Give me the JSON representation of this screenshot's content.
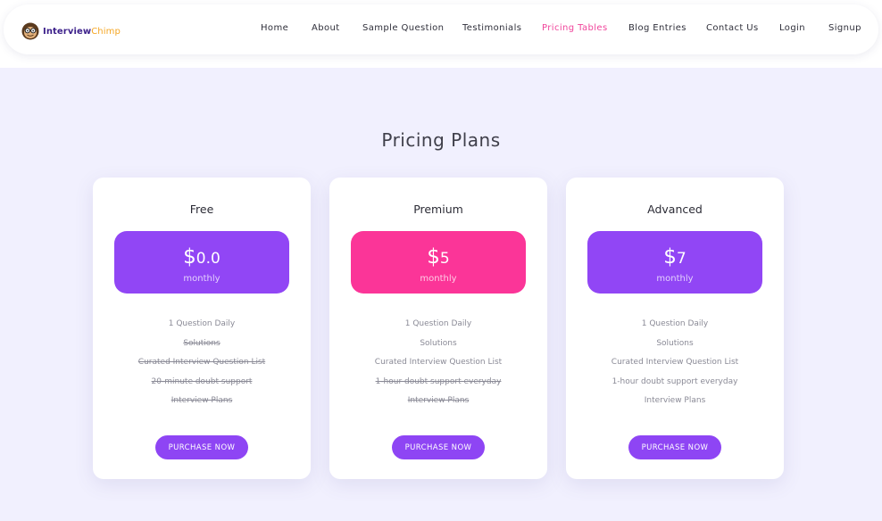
{
  "logo": {
    "part1": "Interview",
    "part2": "Chimp"
  },
  "nav": {
    "items": [
      {
        "label": "Home",
        "active": false
      },
      {
        "label": "About",
        "active": false
      },
      {
        "label": "Sample Question",
        "active": false
      },
      {
        "label": "Testimonials",
        "active": false
      },
      {
        "label": "Pricing Tables",
        "active": true
      },
      {
        "label": "Blog Entries",
        "active": false
      },
      {
        "label": "Contact Us",
        "active": false
      },
      {
        "label": "Login",
        "active": false
      },
      {
        "label": "Signup",
        "active": false
      }
    ],
    "active_color": "#f0459b"
  },
  "page": {
    "title": "Pricing Plans"
  },
  "colors": {
    "purple": "#9146f5",
    "pink": "#fb3598",
    "button": "#8e45f4",
    "background": "#f1f0fe"
  },
  "plans": [
    {
      "name": "Free",
      "currency": "$",
      "price": "0.0",
      "period": "monthly",
      "accent": "#9146f5",
      "features": [
        {
          "text": "1 Question Daily",
          "included": true
        },
        {
          "text": "Solutions",
          "included": false
        },
        {
          "text": "Curated Interview Question List",
          "included": false
        },
        {
          "text": "20-minute doubt support",
          "included": false
        },
        {
          "text": "Interview Plans",
          "included": false
        }
      ],
      "button": "PURCHASE NOW"
    },
    {
      "name": "Premium",
      "currency": "$",
      "price": "5",
      "period": "monthly",
      "accent": "#fb3598",
      "features": [
        {
          "text": "1 Question Daily",
          "included": true
        },
        {
          "text": "Solutions",
          "included": true
        },
        {
          "text": "Curated Interview Question List",
          "included": true
        },
        {
          "text": "1-hour doubt support everyday",
          "included": false
        },
        {
          "text": "Interview Plans",
          "included": false
        }
      ],
      "button": "PURCHASE NOW"
    },
    {
      "name": "Advanced",
      "currency": "$",
      "price": "7",
      "period": "monthly",
      "accent": "#9146f5",
      "features": [
        {
          "text": "1 Question Daily",
          "included": true
        },
        {
          "text": "Solutions",
          "included": true
        },
        {
          "text": "Curated Interview Question List",
          "included": true
        },
        {
          "text": "1-hour doubt support everyday",
          "included": true
        },
        {
          "text": "Interview Plans",
          "included": true
        }
      ],
      "button": "PURCHASE NOW"
    }
  ]
}
